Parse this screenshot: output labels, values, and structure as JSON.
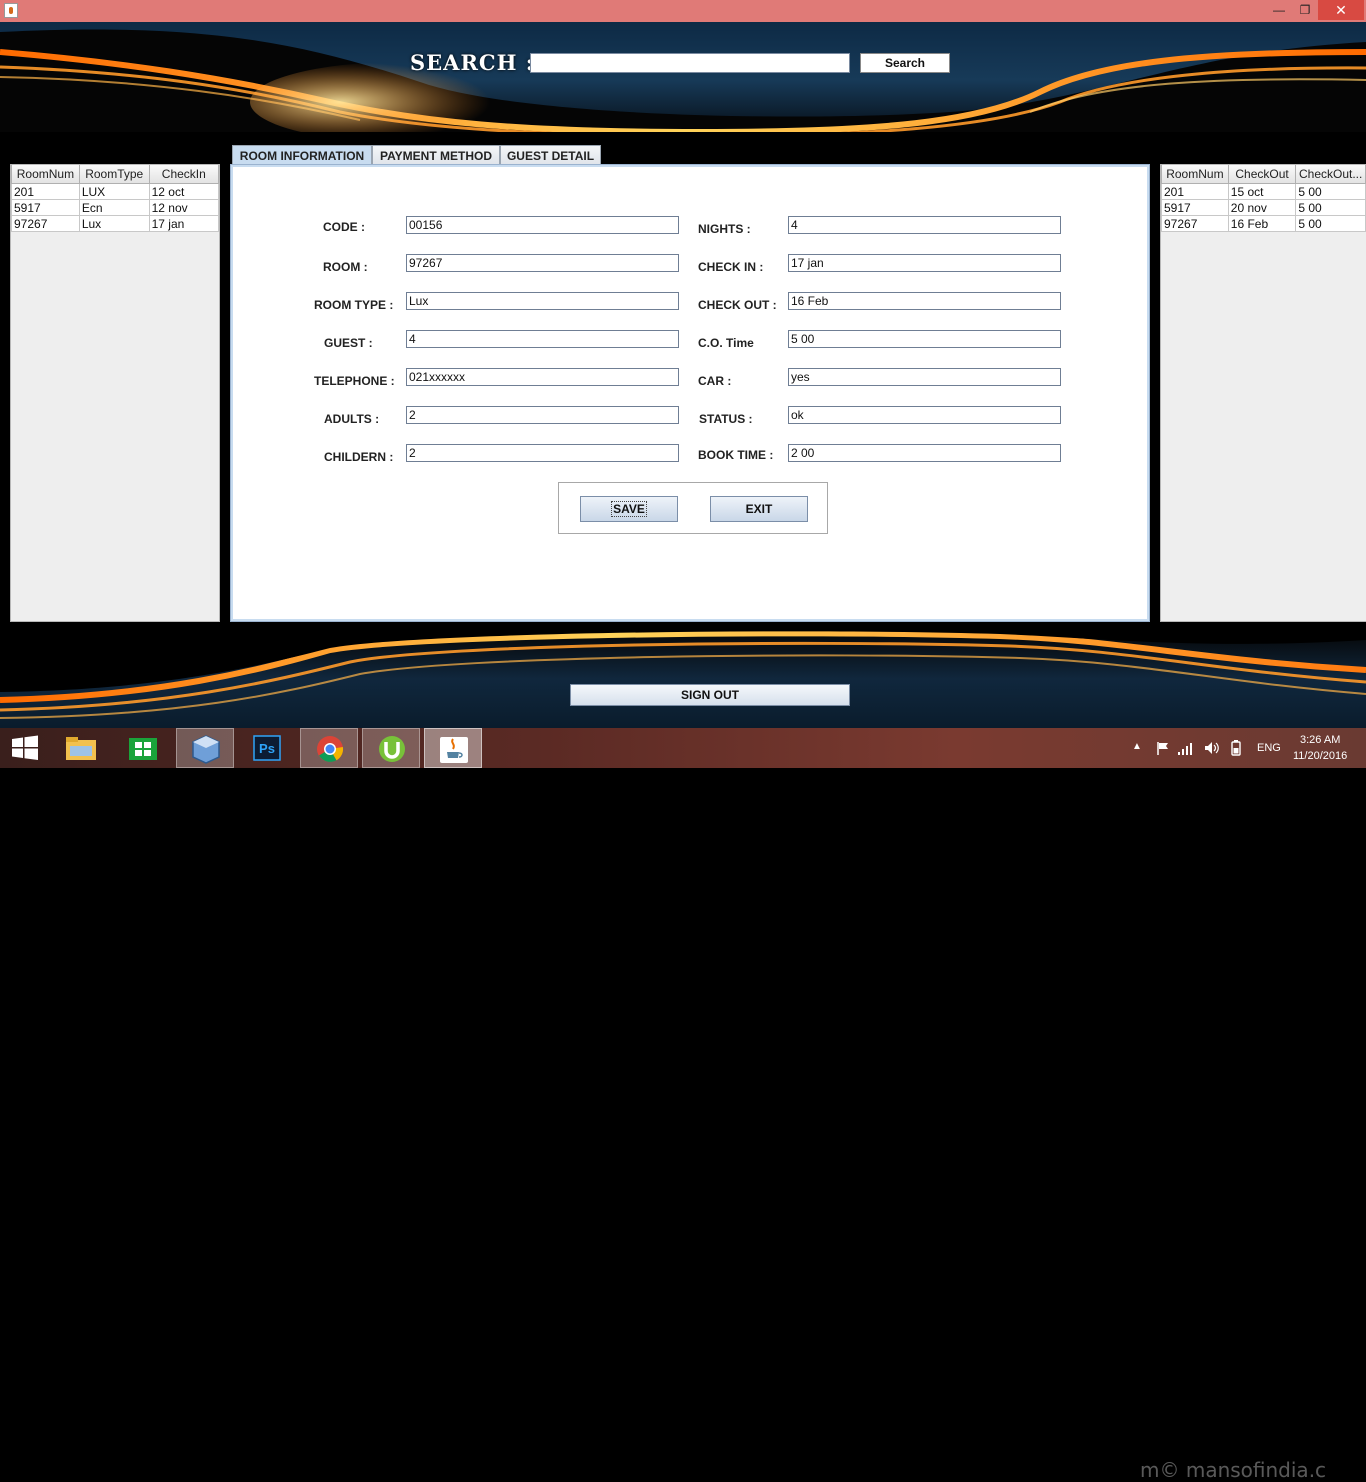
{
  "window": {
    "minimize_glyph": "—",
    "maximize_glyph": "❐",
    "close_glyph": "✕",
    "icon": "java-app-icon"
  },
  "search": {
    "label": "SEARCH :",
    "value": "",
    "button_label": "Search"
  },
  "left_table": {
    "columns": [
      "RoomNum",
      "RoomType",
      "CheckIn"
    ],
    "rows": [
      [
        "201",
        "LUX",
        "12 oct"
      ],
      [
        "5917",
        "Ecn",
        "12 nov"
      ],
      [
        "97267",
        "Lux",
        "17 jan"
      ]
    ]
  },
  "right_table": {
    "columns": [
      "RoomNum",
      "CheckOut",
      "CheckOut..."
    ],
    "rows": [
      [
        "201",
        "15 oct",
        "5 00"
      ],
      [
        "5917",
        "20 nov",
        "5 00"
      ],
      [
        "97267",
        "16 Feb",
        "5 00"
      ]
    ]
  },
  "tabs": [
    "ROOM INFORMATION",
    "PAYMENT METHOD",
    "GUEST DETAIL"
  ],
  "active_tab": "ROOM INFORMATION",
  "form": {
    "left": [
      {
        "label": "CODE :",
        "value": "00156"
      },
      {
        "label": "ROOM :",
        "value": "97267"
      },
      {
        "label": "ROOM TYPE :",
        "value": "Lux"
      },
      {
        "label": "GUEST :",
        "value": "4"
      },
      {
        "label": "TELEPHONE :",
        "value": "021xxxxxx"
      },
      {
        "label": "ADULTS :",
        "value": "2"
      },
      {
        "label": "CHILDERN :",
        "value": "2"
      }
    ],
    "right": [
      {
        "label": "NIGHTS :",
        "value": "4"
      },
      {
        "label": "CHECK IN :",
        "value": "17 jan"
      },
      {
        "label": "CHECK OUT :",
        "value": "16 Feb"
      },
      {
        "label": "C.O. Time",
        "value": "5 00"
      },
      {
        "label": "CAR :",
        "value": "yes"
      },
      {
        "label": "STATUS :",
        "value": "ok"
      },
      {
        "label": "BOOK TIME :",
        "value": "2 00"
      }
    ]
  },
  "actions": {
    "save": "SAVE",
    "exit": "EXIT",
    "sign_out": "SIGN OUT"
  },
  "taskbar": {
    "apps": [
      "start-icon",
      "file-explorer-icon",
      "store-icon",
      "virtualbox-icon",
      "photoshop-icon",
      "chrome-icon",
      "utorrent-icon",
      "java-icon"
    ],
    "photoshop_text": "Ps",
    "language": "ENG",
    "time": "3:26 AM",
    "date": "11/20/2016",
    "watermark": "m© mansofindia.c"
  },
  "colors": {
    "title_bar": "#e07a77",
    "tab_active": "#c8dcf0",
    "flame_orange": "#ff8a1c"
  }
}
